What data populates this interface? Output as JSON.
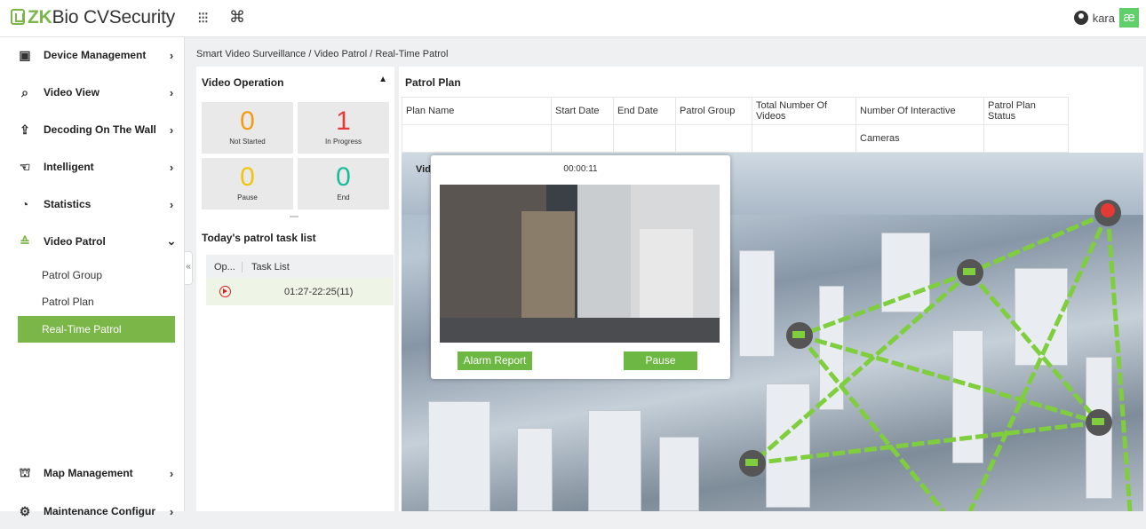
{
  "app": {
    "logo_prefix": "ZK",
    "logo_suffix": "Bio CVSecurity",
    "apps_icon": "⁝⁝⁝",
    "cmd_icon": "⌘",
    "user": "kara",
    "user_badge": "æ"
  },
  "sidebar": {
    "items": [
      {
        "label": "Device Management",
        "icon": "device-icon",
        "glyph": "▣"
      },
      {
        "label": "Video View",
        "icon": "video-view-icon",
        "glyph": "⌕"
      },
      {
        "label": "Decoding On The Wall",
        "icon": "decoding-icon",
        "glyph": "⇪"
      },
      {
        "label": "Intelligent",
        "icon": "intelligent-icon",
        "glyph": "☜"
      },
      {
        "label": "Statistics",
        "icon": "statistics-icon",
        "glyph": "◔"
      },
      {
        "label": "Video Patrol",
        "icon": "video-patrol-icon",
        "glyph": "≙"
      }
    ],
    "submenu": [
      "Patrol Group",
      "Patrol Plan",
      "Real-Time Patrol"
    ],
    "bottom": [
      {
        "label": "Map Management",
        "icon": "map-management-icon",
        "glyph": "⛫"
      },
      {
        "label": "Maintenance Configur",
        "icon": "maintenance-icon",
        "glyph": "⚙"
      }
    ]
  },
  "breadcrumb": "Smart Video Surveillance / Video Patrol / Real-Time Patrol",
  "video_operation": {
    "title": "Video Operation",
    "stats": [
      {
        "value": "0",
        "label": "Not Started",
        "color": "#f39c12"
      },
      {
        "value": "1",
        "label": "In Progress",
        "color": "#e53935"
      },
      {
        "value": "0",
        "label": "Pause",
        "color": "#f1c40f"
      },
      {
        "value": "0",
        "label": "End",
        "color": "#1abc9c"
      }
    ]
  },
  "task_list": {
    "title": "Today's patrol task list",
    "columns": [
      "Op...",
      "Task List"
    ],
    "rows": [
      {
        "time": "01:27-22:25(11)"
      }
    ]
  },
  "patrol_plan": {
    "title": "Patrol Plan",
    "columns": [
      "Plan Name",
      "Start Date",
      "End Date",
      "Patrol Group",
      "Total Number Of Videos",
      "Number Of Interactive",
      "Patrol Plan Status"
    ],
    "column_extra": "Cameras"
  },
  "video_popup": {
    "label": "Vid",
    "timer": "00:00:11",
    "alarm_button": "Alarm Report",
    "pause_button": "Pause"
  },
  "colors": {
    "accent": "#7ab648",
    "route": "#7fce3e"
  }
}
